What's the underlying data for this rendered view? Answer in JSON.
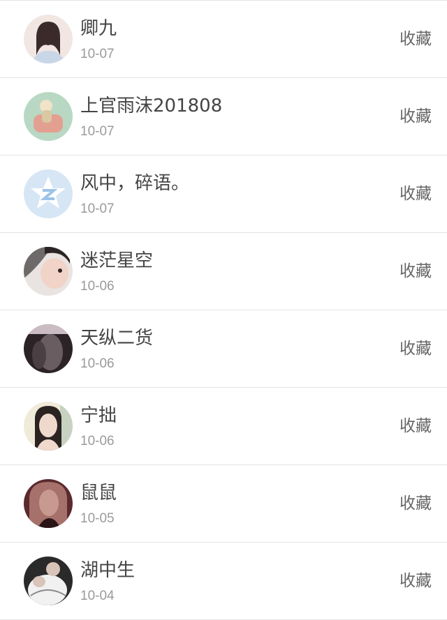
{
  "followers": [
    {
      "name": "卿九",
      "date": "10-07",
      "action": "收藏",
      "avatar_colors": [
        "#f1e6e2",
        "#3b2a2a",
        "#e8c2b8",
        "#c9d6e8"
      ]
    },
    {
      "name": "上官雨沫201808",
      "date": "10-07",
      "action": "收藏",
      "avatar_colors": [
        "#b8d8c4",
        "#e3a091",
        "#d9c8a2",
        "#f2e2c8"
      ]
    },
    {
      "name": "风中，碎语。",
      "date": "10-07",
      "action": "收藏",
      "avatar_colors": [
        "#d6e6f4",
        "#ffffff",
        "#9cc3e8",
        "#ffffff"
      ]
    },
    {
      "name": "迷茫星空",
      "date": "10-06",
      "action": "收藏",
      "avatar_colors": [
        "#6e6a6a",
        "#f1d3c8",
        "#2a2426",
        "#e9e4e2"
      ]
    },
    {
      "name": "天纵二货",
      "date": "10-06",
      "action": "收藏",
      "avatar_colors": [
        "#2c2326",
        "#6a5d62",
        "#4a3f42",
        "#cbbcc3"
      ]
    },
    {
      "name": "宁拙",
      "date": "10-06",
      "action": "收藏",
      "avatar_colors": [
        "#f0ead8",
        "#2b2322",
        "#efd9cd",
        "#c8d2c0"
      ]
    },
    {
      "name": "鼠鼠",
      "date": "10-05",
      "action": "收藏",
      "avatar_colors": [
        "#5a2a2e",
        "#a7716b",
        "#2a1618",
        "#c89a8f"
      ]
    },
    {
      "name": "湖中生",
      "date": "10-04",
      "action": "收藏",
      "avatar_colors": [
        "#2a2a2a",
        "#f1f1f1",
        "#d8c4b8",
        "#8a8a8a"
      ]
    }
  ]
}
